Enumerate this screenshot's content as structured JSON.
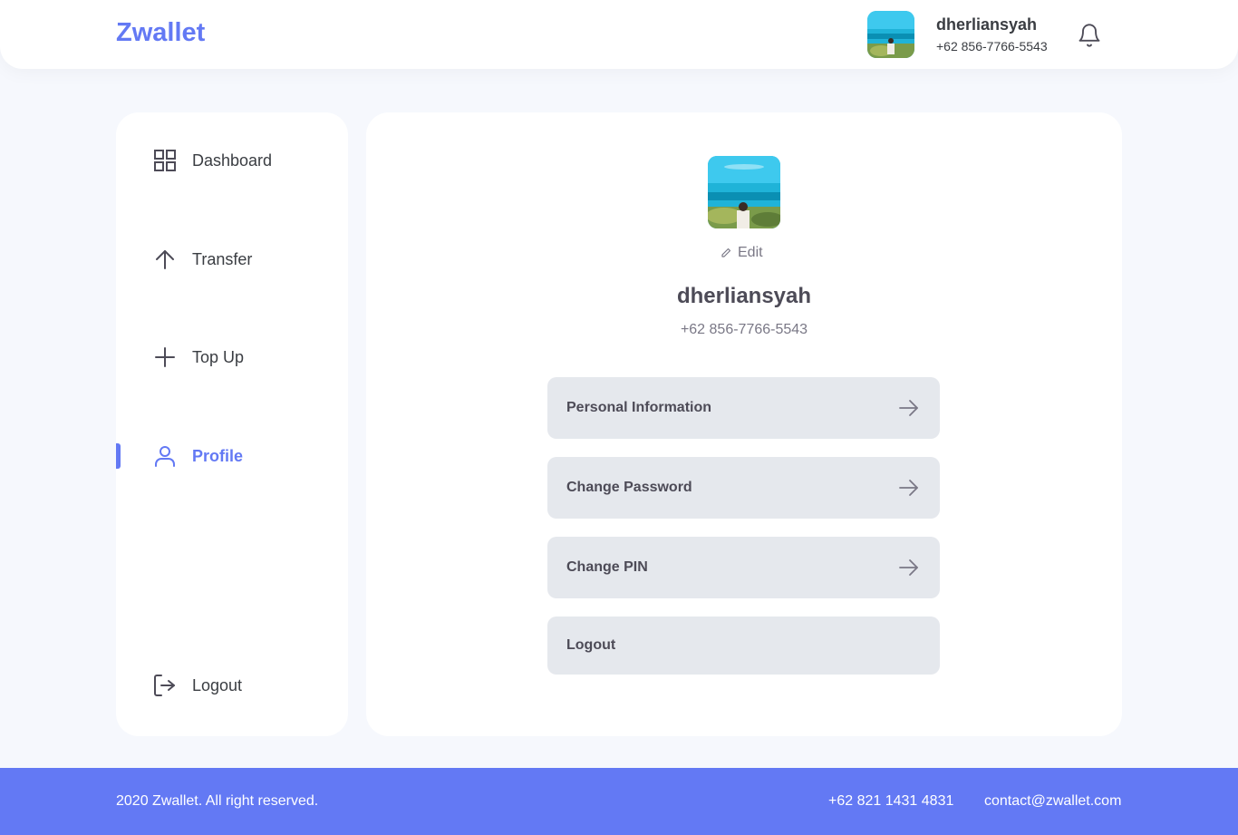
{
  "app": {
    "brand": "Zwallet"
  },
  "header": {
    "user_name": "dherliansyah",
    "user_phone": "+62 856-7766-5543"
  },
  "sidebar": {
    "items": [
      {
        "label": "Dashboard",
        "icon": "grid-icon"
      },
      {
        "label": "Transfer",
        "icon": "arrow-up-icon"
      },
      {
        "label": "Top Up",
        "icon": "plus-icon"
      },
      {
        "label": "Profile",
        "icon": "user-icon",
        "active": true
      }
    ],
    "logout": {
      "label": "Logout",
      "icon": "logout-icon"
    }
  },
  "profile": {
    "edit_label": "Edit",
    "name": "dherliansyah",
    "phone": "+62 856-7766-5543",
    "menu": [
      {
        "label": "Personal Information",
        "has_arrow": true
      },
      {
        "label": "Change Password",
        "has_arrow": true
      },
      {
        "label": "Change PIN",
        "has_arrow": true
      },
      {
        "label": "Logout",
        "has_arrow": false
      }
    ]
  },
  "footer": {
    "copyright": "2020 Zwallet. All right reserved.",
    "phone": "+62 821 1431 4831",
    "email": "contact@zwallet.com"
  },
  "colors": {
    "primary": "#6379f4",
    "menu_bg": "#e5e8ed",
    "page_bg": "#f6f8fd"
  }
}
